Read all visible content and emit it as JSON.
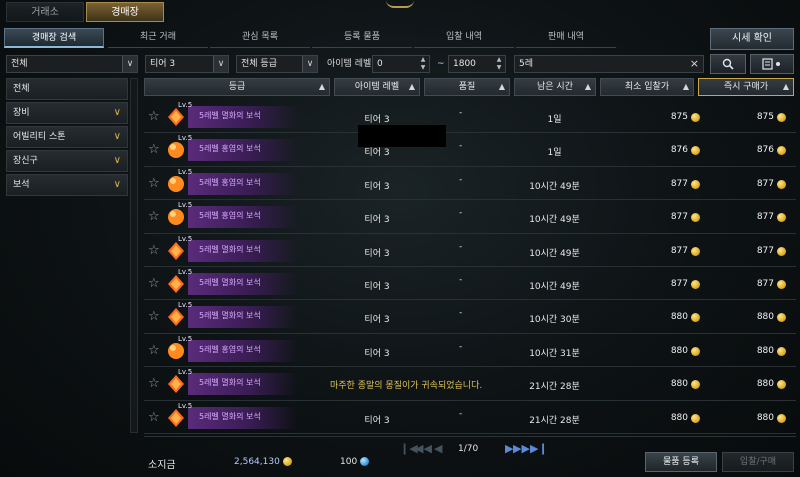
{
  "top_tabs": [
    "거래소",
    "경매장"
  ],
  "active_top_tab": "경매장",
  "sub_tabs": [
    "경매장 검색",
    "최근 거래",
    "관심 목록",
    "등록 물품",
    "입찰 내역",
    "판매 내역"
  ],
  "price_check_label": "시세 확인",
  "filters": {
    "category": "전체",
    "tier": "티어 3",
    "grade": "전체 등급",
    "item_level_label": "아이템 레벨",
    "item_level_min": "0",
    "item_level_sep": "~",
    "item_level_max": "1800",
    "search_value": "5레",
    "clear_icon": "×"
  },
  "sidebar": [
    "전체",
    "장비",
    "어빌리티 스톤",
    "장신구",
    "보석"
  ],
  "table": {
    "headers": [
      "등급",
      "아이템 레벨",
      "품질",
      "남은 시간",
      "최소 입찰가",
      "즉시 구매가"
    ],
    "rows": [
      {
        "lv": "Lv.5",
        "name": "5레벨 멸화의 보석",
        "tier": "티어 3",
        "quality": "-",
        "time": "1일",
        "bid": "875",
        "buy": "875",
        "gem": "blue"
      },
      {
        "lv": "Lv.5",
        "name": "5레벨 홍염의 보석",
        "tier": "티어 3",
        "quality": "-",
        "time": "1일",
        "bid": "876",
        "buy": "876",
        "gem": "orange"
      },
      {
        "lv": "Lv.5",
        "name": "5레벨 홍염의 보석",
        "tier": "티어 3",
        "quality": "-",
        "time": "10시간 49분",
        "bid": "877",
        "buy": "877",
        "gem": "orange"
      },
      {
        "lv": "Lv.5",
        "name": "5레벨 홍염의 보석",
        "tier": "티어 3",
        "quality": "-",
        "time": "10시간 49분",
        "bid": "877",
        "buy": "877",
        "gem": "orange"
      },
      {
        "lv": "Lv.5",
        "name": "5레벨 멸화의 보석",
        "tier": "티어 3",
        "quality": "-",
        "time": "10시간 49분",
        "bid": "877",
        "buy": "877",
        "gem": "blue"
      },
      {
        "lv": "Lv.5",
        "name": "5레벨 멸화의 보석",
        "tier": "티어 3",
        "quality": "-",
        "time": "10시간 49분",
        "bid": "877",
        "buy": "877",
        "gem": "blue"
      },
      {
        "lv": "Lv.5",
        "name": "5레벨 멸화의 보석",
        "tier": "티어 3",
        "quality": "-",
        "time": "10시간 30분",
        "bid": "880",
        "buy": "880",
        "gem": "blue"
      },
      {
        "lv": "Lv.5",
        "name": "5레벨 홍염의 보석",
        "tier": "티어 3",
        "quality": "-",
        "time": "10시간 31분",
        "bid": "880",
        "buy": "880",
        "gem": "orange"
      },
      {
        "lv": "Lv.5",
        "name": "5레벨 멸화의 보석",
        "tier": "",
        "quality": "",
        "time": "21시간 28분",
        "bid": "880",
        "buy": "880",
        "gem": "blue"
      },
      {
        "lv": "Lv.5",
        "name": "5레벨 멸화의 보석",
        "tier": "티어 3",
        "quality": "-",
        "time": "21시간 28분",
        "bid": "880",
        "buy": "880",
        "gem": "blue"
      }
    ]
  },
  "notice": "마주한 종말의 몽질이가 귀속되었습니다.",
  "pagination": {
    "current": "1/70",
    "first": "❙◀",
    "prev2": "◀◀",
    "prev": "◀",
    "next": "▶",
    "next2": "▶▶",
    "last": "▶❙"
  },
  "footer": {
    "gold_label": "소지금",
    "gold_value": "2,564,130",
    "crystal_value": "100",
    "register_label": "물품 등록",
    "bid_buy_label": "입찰/구매"
  },
  "colors": {
    "accent": "#c9a54e",
    "gem_name": "#d7a9ff",
    "coin": "#e0b02a"
  }
}
